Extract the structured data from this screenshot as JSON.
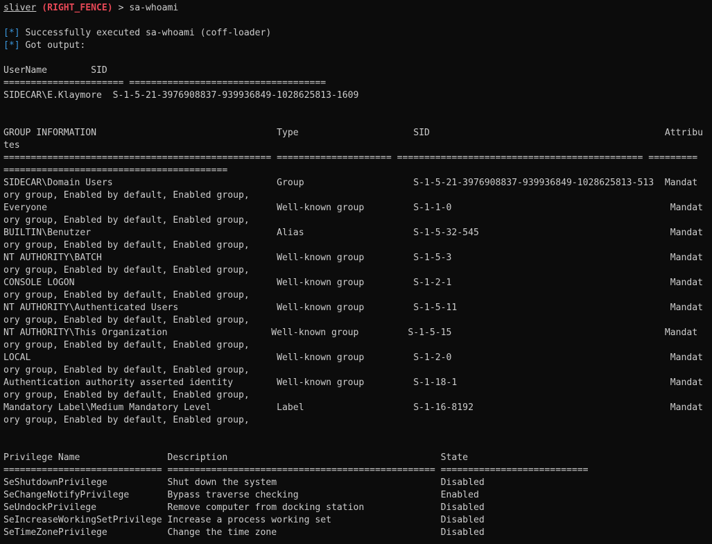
{
  "window": {
    "prompt": {
      "host": "sliver",
      "session": "(RIGHT_FENCE)",
      "symbol": ">",
      "command": "sa-whoami"
    },
    "lines": [
      "",
      "[*] Successfully executed sa-whoami (coff-loader)",
      "[*] Got output:",
      "",
      "UserName        SID",
      "====================== ====================================",
      "SIDECAR\\E.Klaymore  S-1-5-21-3976908837-939936849-1028625813-1609",
      "",
      "",
      "GROUP INFORMATION                                 Type                     SID                                           Attribu",
      "tes",
      "================================================= ===================== ============================================= =========",
      "=========================================",
      "SIDECAR\\Domain Users                              Group                    S-1-5-21-3976908837-939936849-1028625813-513  Mandat",
      "ory group, Enabled by default, Enabled group,",
      "Everyone                                          Well-known group         S-1-1-0                                        Mandat",
      "ory group, Enabled by default, Enabled group,",
      "BUILTIN\\Benutzer                                  Alias                    S-1-5-32-545                                   Mandat",
      "ory group, Enabled by default, Enabled group,",
      "NT AUTHORITY\\BATCH                                Well-known group         S-1-5-3                                        Mandat",
      "ory group, Enabled by default, Enabled group,",
      "CONSOLE LOGON                                     Well-known group         S-1-2-1                                        Mandat",
      "ory group, Enabled by default, Enabled group,",
      "NT AUTHORITY\\Authenticated Users                  Well-known group         S-1-5-11                                       Mandat",
      "ory group, Enabled by default, Enabled group,",
      "NT AUTHORITY\\This Organization                   Well-known group         S-1-5-15                                       Mandat",
      "ory group, Enabled by default, Enabled group,",
      "LOCAL                                             Well-known group         S-1-2-0                                        Mandat",
      "ory group, Enabled by default, Enabled group,",
      "Authentication authority asserted identity        Well-known group         S-1-18-1                                       Mandat",
      "ory group, Enabled by default, Enabled group,",
      "Mandatory Label\\Medium Mandatory Level            Label                    S-1-16-8192                                    Mandat",
      "ory group, Enabled by default, Enabled group,",
      "",
      "",
      "Privilege Name                Description                                       State",
      "============================= ================================================= ===========================",
      "SeShutdownPrivilege           Shut down the system                              Disabled",
      "SeChangeNotifyPrivilege       Bypass traverse checking                          Enabled",
      "SeUndockPrivilege             Remove computer from docking station              Disabled",
      "SeIncreaseWorkingSetPrivilege Increase a process working set                    Disabled",
      "SeTimeZonePrivilege           Change the time zone                              Disabled"
    ],
    "status_marker": "[*]",
    "colors": {
      "background": "#0c0c0c",
      "foreground": "#cccccc",
      "session": "#e74856",
      "status_marker": "#3a96dd"
    }
  }
}
